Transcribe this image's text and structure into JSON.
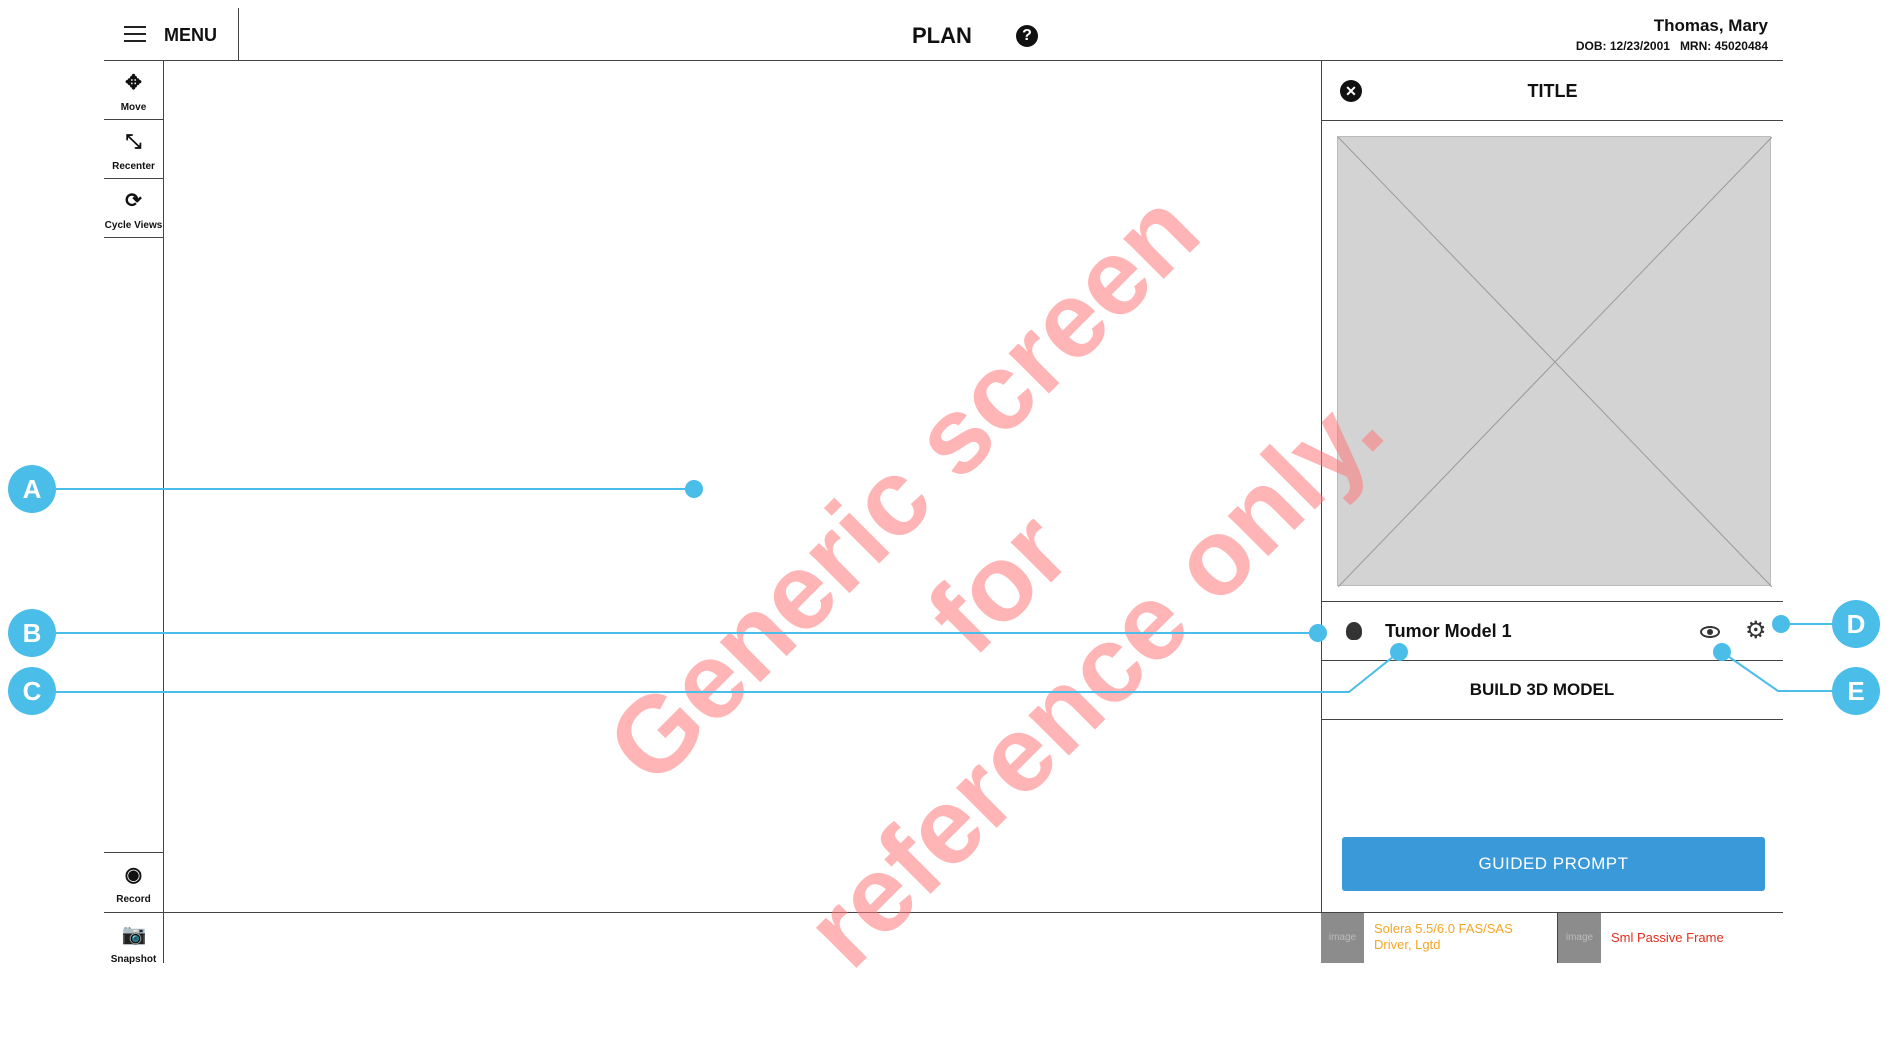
{
  "header": {
    "menu_label": "MENU",
    "title": "PLAN",
    "help_glyph": "?",
    "patient_name": "Thomas, Mary",
    "dob": "DOB: 12/23/2001",
    "mrn": "MRN: 45020484"
  },
  "left_toolbar": {
    "move": "Move",
    "recenter": "Recenter",
    "cycle_views": "Cycle Views",
    "record": "Record",
    "snapshot": "Snapshot"
  },
  "panel": {
    "title": "TITLE",
    "model_name": "Tumor Model 1",
    "build_label": "BUILD 3D MODEL",
    "guided_prompt": "GUIDED PROMPT"
  },
  "tray": {
    "item1_image": "image",
    "item1_label": "Solera 5.5/6.0 FAS/SAS Driver, Lgtd",
    "item1_color": "#f5a623",
    "item2_image": "image",
    "item2_label": "Sml Passive Frame",
    "item2_color": "#e0301e"
  },
  "annotations": {
    "a": "A",
    "b": "B",
    "c": "C",
    "d": "D",
    "e": "E",
    "color": "#4bbde9"
  },
  "watermark": {
    "line1": "Generic screen for",
    "line2": "reference only."
  },
  "icons": [
    "hamburger-icon",
    "help-icon",
    "move-icon",
    "recenter-icon",
    "cycle-views-icon",
    "record-icon",
    "snapshot-icon",
    "close-icon",
    "brain-icon",
    "eye-icon",
    "gear-icon"
  ]
}
